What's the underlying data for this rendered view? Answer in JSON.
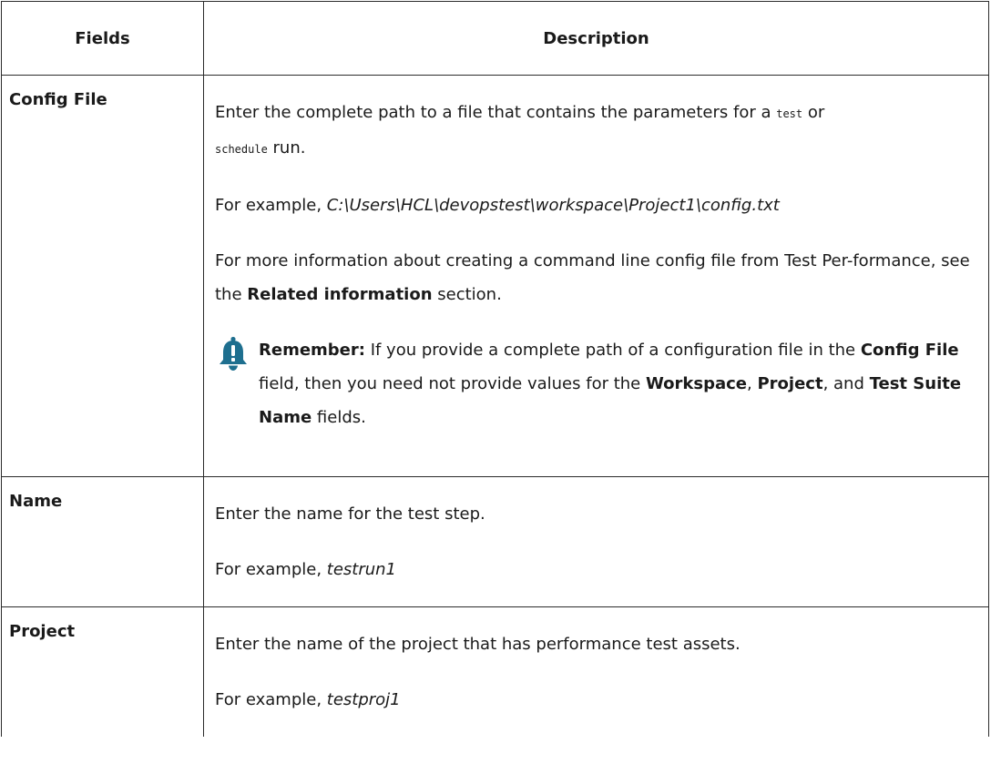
{
  "table": {
    "headers": {
      "fields": "Fields",
      "description": "Description"
    },
    "rows": [
      {
        "field": "Config File",
        "desc_intro_pre": "Enter the complete path to a file that contains the parameters for a ",
        "desc_intro_code1": "test",
        "desc_intro_mid": " or",
        "desc_intro_code2": "schedule",
        "desc_intro_post": " run.",
        "example_prefix": "For example, ",
        "example_value": "C:\\Users\\HCL\\devopstest\\workspace\\Project1\\config.txt",
        "more_info_pre": "For more information about creating a command line config file from Test Per-formance, see the ",
        "more_info_bold": "Related information",
        "more_info_post": " section.",
        "note": {
          "icon": "bell-icon",
          "icon_color": "#1e6f8f",
          "label": "Remember:",
          "text_1": " If you provide a complete path of a configuration file in the ",
          "bold_1": "Config File",
          "text_2": " field, then you need not provide values for the ",
          "bold_2": "Workspace",
          "text_3": ", ",
          "bold_3": "Project",
          "text_4": ", and ",
          "bold_4": "Test Suite Name",
          "text_5": " fields."
        }
      },
      {
        "field": "Name",
        "desc": "Enter the name for the test step.",
        "example_prefix": "For example, ",
        "example_value": "testrun1"
      },
      {
        "field": "Project",
        "desc": "Enter the name of the project that has performance test assets.",
        "example_prefix": "For example, ",
        "example_value": "testproj1"
      }
    ]
  }
}
